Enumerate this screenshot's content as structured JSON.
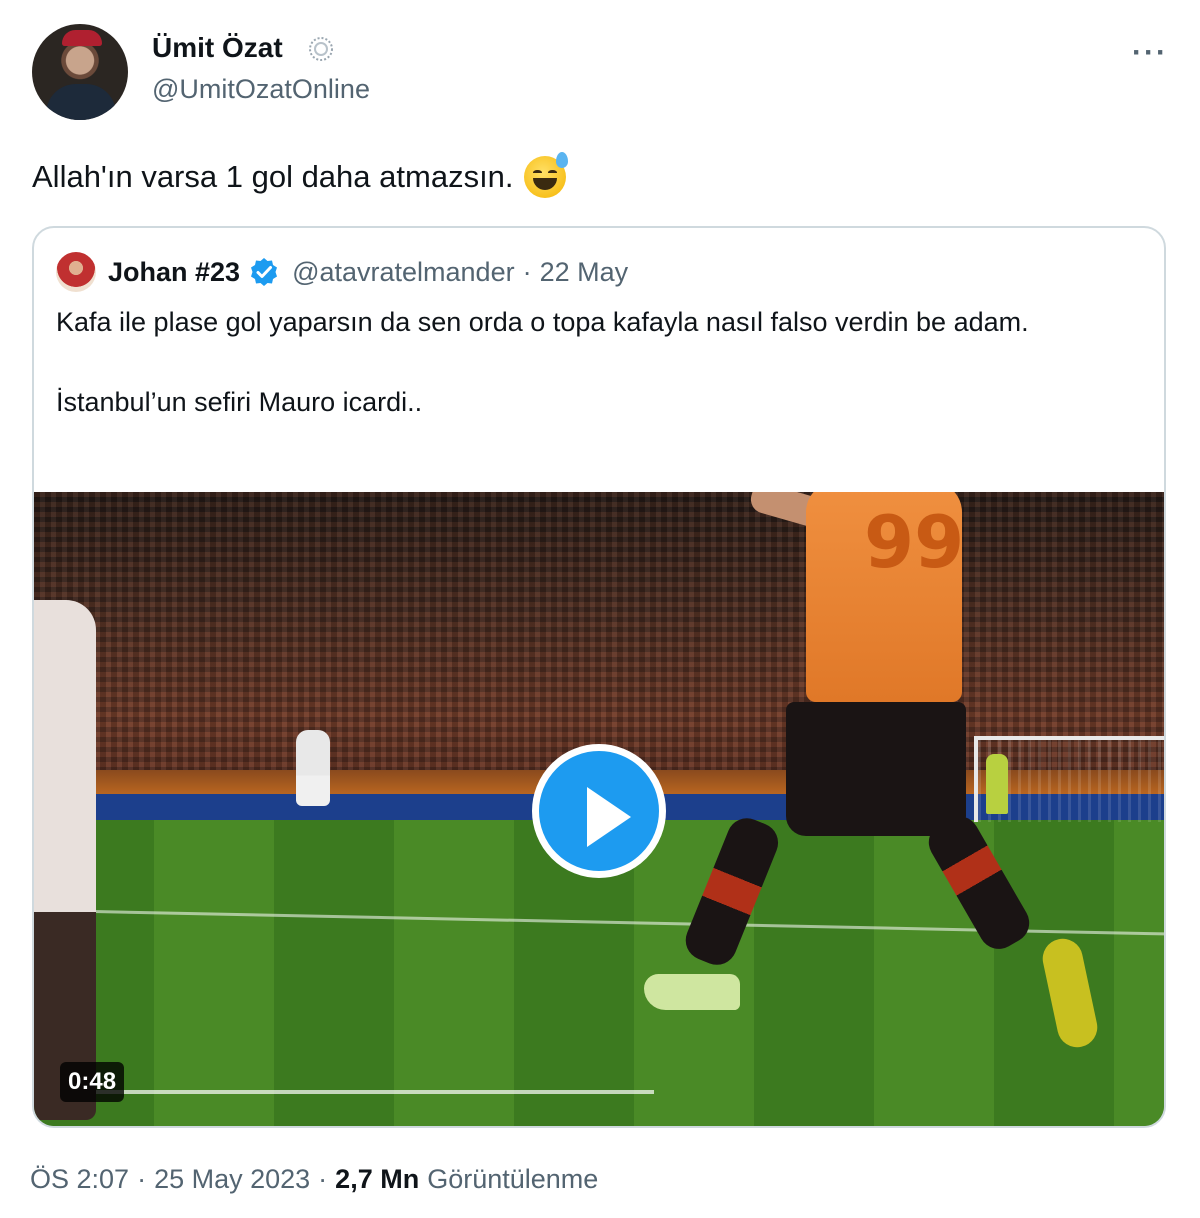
{
  "author": {
    "name": "Ümit Özat",
    "handle": "@UmitOzatOnline"
  },
  "tweet": {
    "text": "Allah'ın varsa 1 gol daha atmazsın."
  },
  "quoted": {
    "name": "Johan #23",
    "handle": "@atavratelmander",
    "separator": "·",
    "date": "22 May",
    "line1": "Kafa ile plase gol yaparsın da sen orda o topa kafayla nasıl falso verdin be adam.",
    "line2": "İstanbul’un sefiri Mauro icardi..",
    "jersey_number": "99",
    "video_duration": "0:48"
  },
  "meta": {
    "time": "ÖS 2:07",
    "date": "25 May 2023",
    "separator": "·",
    "views_count": "2,7 Mn",
    "views_label": "Görüntülenme"
  },
  "icons": {
    "more": "more-icon",
    "verified": "verified-icon",
    "badge": "affiliate-badge-icon",
    "play": "play-icon",
    "emoji": "sweat-smile-emoji"
  },
  "colors": {
    "accent": "#1d9bf0",
    "secondary_text": "#536471",
    "primary_text": "#0f1419",
    "border": "#cfd9de"
  }
}
